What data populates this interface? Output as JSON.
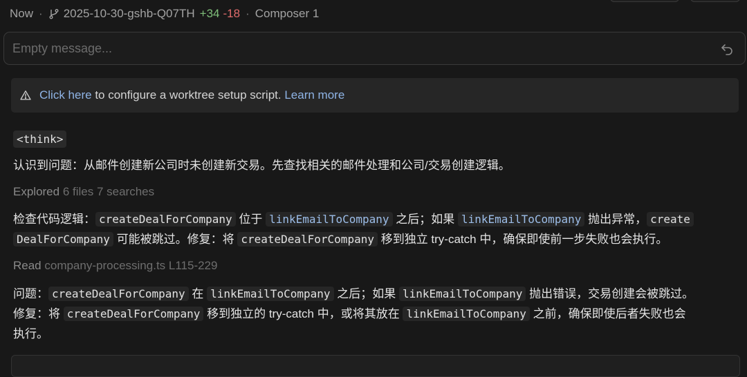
{
  "header": {
    "time": "Now",
    "branch": "2025-10-30-gshb-Q07TH",
    "additions": "+34",
    "deletions": "-18",
    "model": "Composer 1"
  },
  "input": {
    "placeholder": "Empty message..."
  },
  "notice": {
    "link1": "Click here",
    "text": " to configure a worktree setup script. ",
    "link2": "Learn more"
  },
  "content": {
    "think_tag": "<think>",
    "p1": "认识到问题：从邮件创建新公司时未创建新交易。先查找相关的邮件处理和公司/交易创建逻辑。",
    "explored_label": "Explored",
    "explored_detail": " 6 files 7 searches",
    "b1": {
      "t1": "检查代码逻辑：",
      "c1": "createDealForCompany",
      "t2": " 位于 ",
      "c2": "linkEmailToCompany",
      "t3": " 之后；如果 ",
      "c3": "linkEmailToCompany",
      "t4": " 抛出异常，",
      "c4a": "create",
      "c4b": "DealForCompany",
      "t5": " 可能被跳过。修复：将 ",
      "c5": "createDealForCompany",
      "t6": " 移到独立 try-catch 中，确保即使前一步失败也会执行。"
    },
    "read_label": "Read",
    "read_detail": " company-processing.ts L115-229",
    "b2": {
      "t1": "问题：",
      "c1": "createDealForCompany",
      "t2": " 在 ",
      "c2": "linkEmailToCompany",
      "t3": " 之后；如果 ",
      "c3": "linkEmailToCompany",
      "t4": " 抛出错误，交易创建会被跳过。",
      "t5": "修复：将 ",
      "c5": "createDealForCompany",
      "t6": " 移到独立的 try-catch 中，或将其放在 ",
      "c6": "linkEmailToCompany",
      "t7": " 之前，确保即使后者失败也会",
      "t8": "执行。"
    }
  },
  "colors": {
    "background": "#181818",
    "link": "#8fb4e6",
    "additions": "#7fbf7a",
    "deletions": "#e06c6c"
  }
}
